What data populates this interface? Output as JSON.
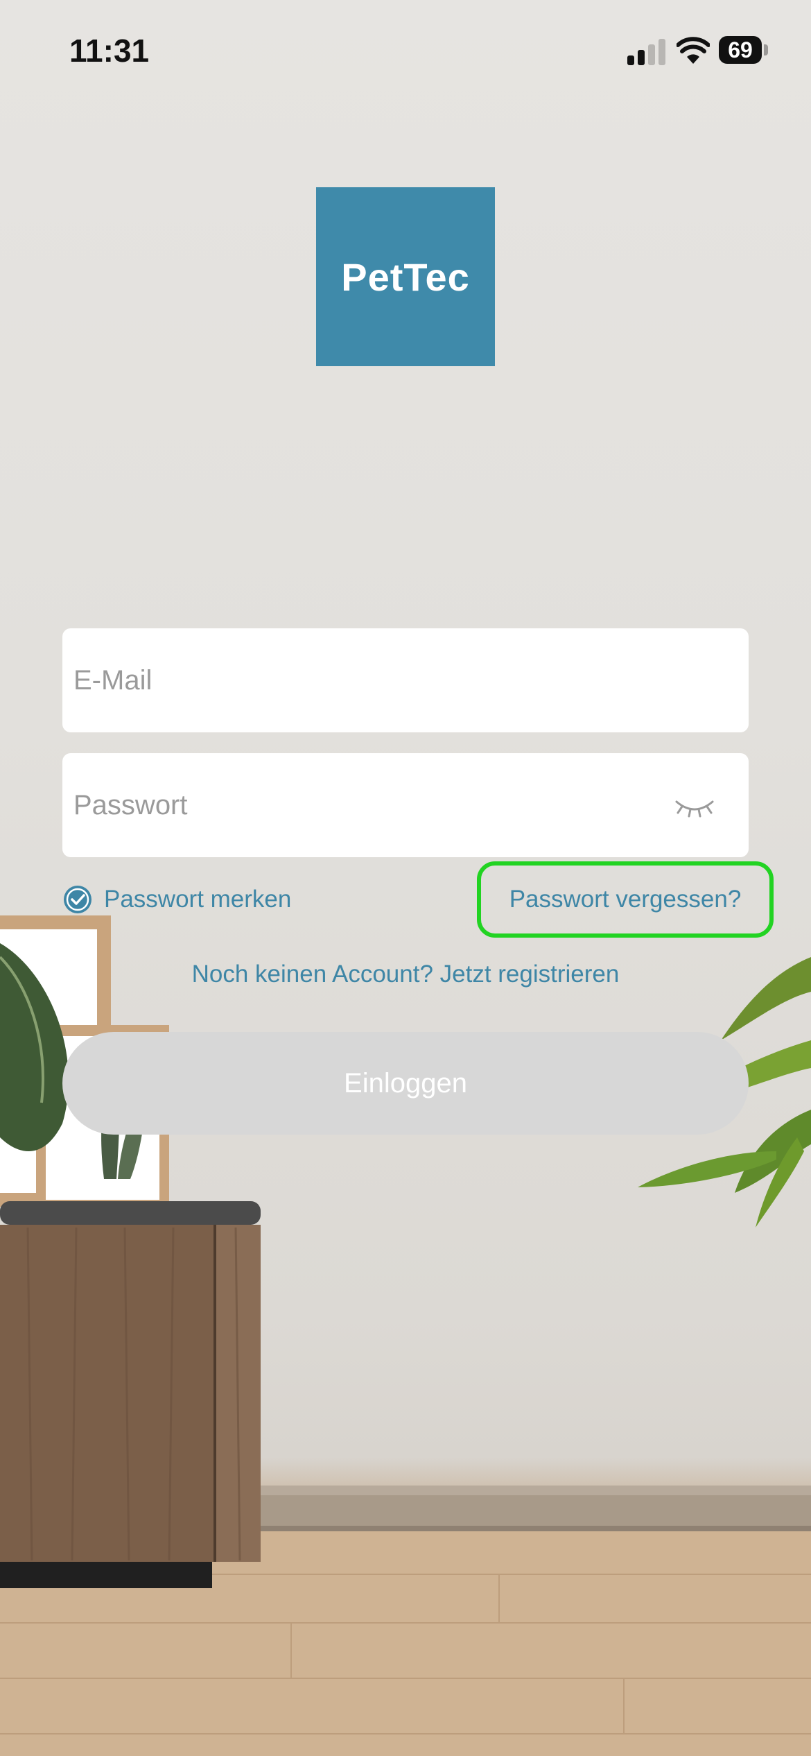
{
  "status_bar": {
    "time": "11:31",
    "battery": "69"
  },
  "logo": {
    "text": "PetTec"
  },
  "form": {
    "email_placeholder": "E-Mail",
    "password_placeholder": "Passwort",
    "remember_label": "Passwort merken",
    "forgot_label": "Passwort vergessen?",
    "register_link": "Noch keinen Account? Jetzt registrieren",
    "login_label": "Einloggen"
  },
  "colors": {
    "accent": "#3e86a6",
    "logo_bg": "#3f8aaa",
    "highlight": "#22d322",
    "button_disabled": "#d7d7d7"
  },
  "icons": [
    "signal-icon",
    "wifi-icon",
    "battery-icon",
    "eye-closed-icon",
    "checkbox-checked-icon"
  ]
}
